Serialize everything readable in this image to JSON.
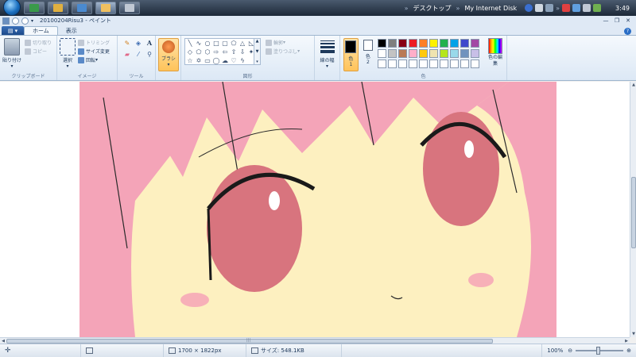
{
  "taskbar": {
    "desktop_label": "デスクトップ",
    "disk_label": "My Internet Disk",
    "clock": "3:49"
  },
  "window": {
    "title": "20100204Risu3 - ペイント"
  },
  "ribbon_tabs": {
    "home": "ホーム",
    "view": "表示"
  },
  "clipboard": {
    "paste": "貼り付け",
    "cut": "切り取り",
    "copy": "コピー",
    "label": "クリップボード"
  },
  "image": {
    "select": "選択",
    "crop": "トリミング",
    "resize": "サイズ変更",
    "rotate": "回転",
    "label": "イメージ"
  },
  "tools": {
    "label": "ツール"
  },
  "brush": {
    "label": "ブラシ"
  },
  "shapes": {
    "outline": "輪郭",
    "fill": "塗りつぶし",
    "label": "図形"
  },
  "line_width": {
    "label": "線の幅"
  },
  "colors": {
    "color1_label": "色",
    "color1_num": "1",
    "color2_label": "色",
    "color2_num": "2",
    "edit_label": "色の編集",
    "label": "色",
    "color1": "#000000",
    "color2": "#ffffff",
    "palette": [
      "#000000",
      "#7f7f7f",
      "#880015",
      "#ed1c24",
      "#ff7f27",
      "#fff200",
      "#22b14c",
      "#00a2e8",
      "#3f48cc",
      "#a349a4",
      "#ffffff",
      "#c3c3c3",
      "#b97a57",
      "#ffaec9",
      "#ffc90e",
      "#efe4b0",
      "#b5e61d",
      "#99d9ea",
      "#7092be",
      "#c8bfe7",
      "#ffffff",
      "#ffffff",
      "#ffffff",
      "#ffffff",
      "#ffffff",
      "#ffffff",
      "#ffffff",
      "#ffffff",
      "#ffffff",
      "#ffffff"
    ]
  },
  "status": {
    "dimensions": "1700 × 1822px",
    "size": "サイズ: 548.1KB",
    "zoom": "100%"
  }
}
